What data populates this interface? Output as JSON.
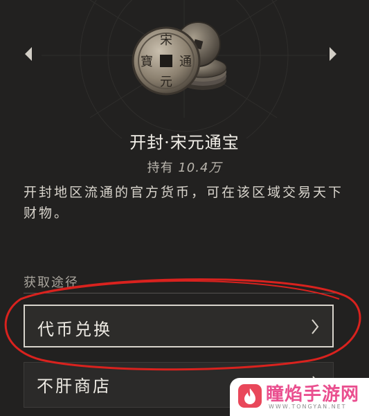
{
  "item": {
    "name": "开封·宋元通宝",
    "holding_prefix": "持有",
    "holding_value": "10.4万",
    "description": "开封地区流通的官方货币，可在该区域交易天下财物。",
    "coin_characters": [
      "宋",
      "通",
      "元",
      "寶"
    ]
  },
  "acquire": {
    "section_label": "获取途径",
    "options": [
      {
        "label": "代币兑换"
      },
      {
        "label": "不肝商店"
      }
    ]
  },
  "watermark": {
    "text": "瞳焰手游网",
    "sub": "WWW.TONGYAN.NET"
  },
  "colors": {
    "background": "#222120",
    "annotation_red": "#d9221e",
    "watermark_pink": "#ea4f8f"
  }
}
